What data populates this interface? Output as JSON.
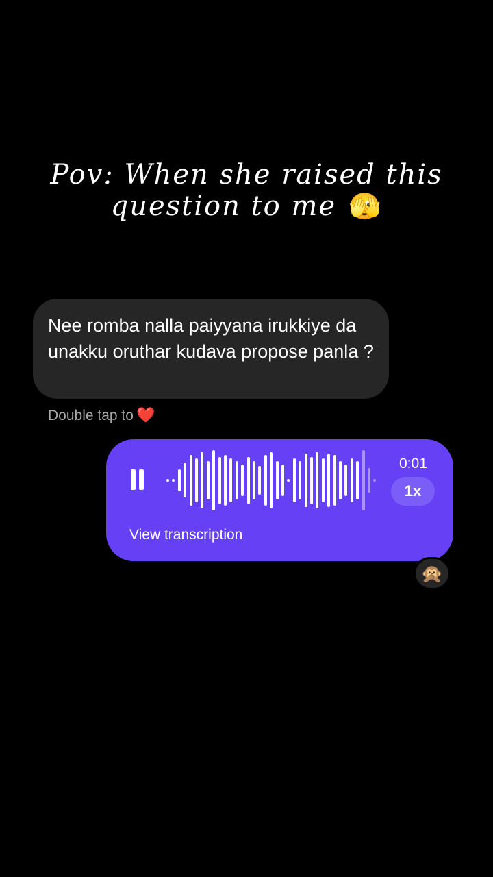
{
  "caption": {
    "line1": "Pov: When she raised this",
    "line2": "question to me",
    "emoji": "🫣"
  },
  "incoming_message": {
    "text": "Nee romba nalla paiyyana irukkiye da unakku oruthar kudava propose panla ?"
  },
  "double_tap_hint": {
    "text": "Double tap to",
    "icon": "❤️"
  },
  "voice_message": {
    "pause_icon": "pause-icon",
    "duration": "0:01",
    "speed": "1x",
    "transcription_label": "View transcription",
    "played_fraction": 0.9,
    "bar_color": "#ffffff",
    "unplayed_color": "#a995fa",
    "background_color": "#6540f5"
  },
  "reaction": {
    "emoji": "🙊"
  }
}
